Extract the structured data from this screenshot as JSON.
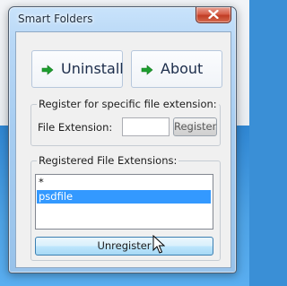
{
  "window": {
    "title": "Smart Folders"
  },
  "actions": {
    "uninstall_label": "Uninstall",
    "about_label": "About"
  },
  "register_group": {
    "legend": "Register for specific file extension:",
    "field_label": "File Extension:",
    "field_value": "",
    "register_label": "Register"
  },
  "registered_group": {
    "legend": "Registered File Extensions:",
    "items": [
      {
        "label": "*",
        "selected": false
      },
      {
        "label": "psdfile",
        "selected": true
      }
    ],
    "unregister_label": "Unregister"
  },
  "colors": {
    "selection": "#3399ff",
    "arrow": "#1e9e2f",
    "close": "#c13d25"
  },
  "icons": [
    "close-icon",
    "green-arrow-icon",
    "mouse-cursor-icon"
  ]
}
